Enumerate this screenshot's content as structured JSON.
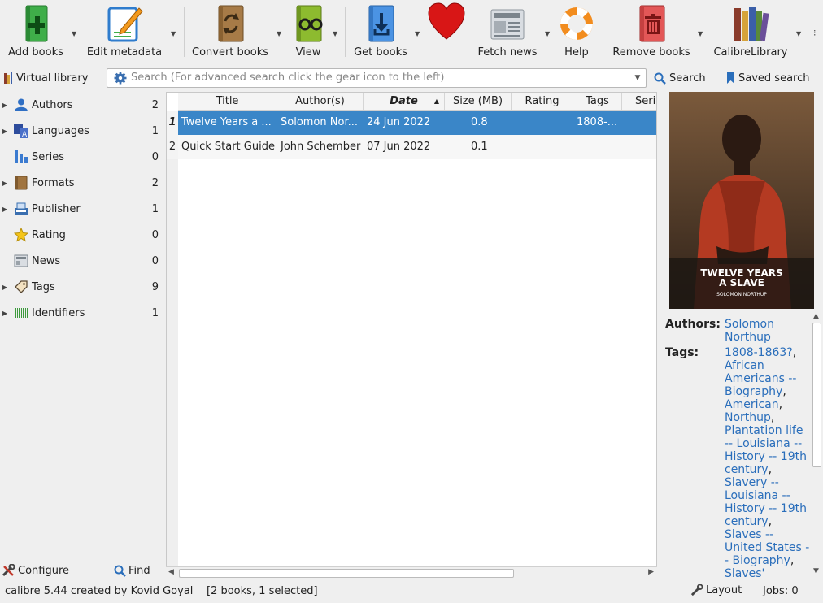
{
  "toolbar": {
    "buttons": [
      {
        "label": "Add books",
        "icon": "add-books-icon"
      },
      {
        "label": "Edit metadata",
        "icon": "edit-metadata-icon"
      },
      {
        "label": "Convert books",
        "icon": "convert-books-icon"
      },
      {
        "label": "View",
        "icon": "view-icon"
      },
      {
        "label": "Get books",
        "icon": "get-books-icon"
      },
      {
        "label": "",
        "icon": "heart-icon"
      },
      {
        "label": "Fetch news",
        "icon": "fetch-news-icon"
      },
      {
        "label": "Help",
        "icon": "help-icon"
      },
      {
        "label": "Remove books",
        "icon": "remove-books-icon"
      },
      {
        "label": "CalibreLibrary",
        "icon": "library-icon"
      }
    ]
  },
  "search": {
    "virtual_library": "Virtual library",
    "placeholder": "Search (For advanced search click the gear icon to the left)",
    "search_label": "Search",
    "saved_search_label": "Saved search"
  },
  "tag_browser": {
    "items": [
      {
        "label": "Authors",
        "count": "2"
      },
      {
        "label": "Languages",
        "count": "1"
      },
      {
        "label": "Series",
        "count": "0"
      },
      {
        "label": "Formats",
        "count": "2"
      },
      {
        "label": "Publisher",
        "count": "1"
      },
      {
        "label": "Rating",
        "count": "0"
      },
      {
        "label": "News",
        "count": "0"
      },
      {
        "label": "Tags",
        "count": "9"
      },
      {
        "label": "Identifiers",
        "count": "1"
      }
    ],
    "configure_label": "Configure",
    "find_label": "Find"
  },
  "book_list": {
    "columns": [
      "Title",
      "Author(s)",
      "Date",
      "Size (MB)",
      "Rating",
      "Tags",
      "Series"
    ],
    "rows": [
      {
        "num": "1",
        "title": "Twelve Years a ...",
        "authors": "Solomon Nor...",
        "date": "24 Jun 2022",
        "size": "0.8",
        "rating": "",
        "tags": "1808-..."
      },
      {
        "num": "2",
        "title": "Quick Start Guide",
        "authors": "John Schember",
        "date": "07 Jun 2022",
        "size": "0.1",
        "rating": "",
        "tags": ""
      }
    ]
  },
  "book_details": {
    "cover_title": "TWELVE YEARS A SLAVE",
    "cover_author": "SOLOMON NORTHUP",
    "authors_label": "Authors:",
    "authors_value": "Solomon Northup",
    "tags_label": "Tags:",
    "tags": [
      "1808-1863?",
      "African Americans -- Biography",
      "American",
      "Northup",
      "Plantation life -- Louisiana -- History -- 19th century",
      "Slavery -- Louisiana -- History -- 19th century",
      "Slaves -- United States -- Biography",
      "Slaves'"
    ]
  },
  "status_bar": {
    "left": "calibre 5.44 created by Kovid Goyal",
    "info": "[2 books, 1 selected]",
    "layout_label": "Layout",
    "jobs": "Jobs: 0"
  },
  "colors": {
    "selection": "#3a86c8",
    "link": "#2a6ebb"
  }
}
